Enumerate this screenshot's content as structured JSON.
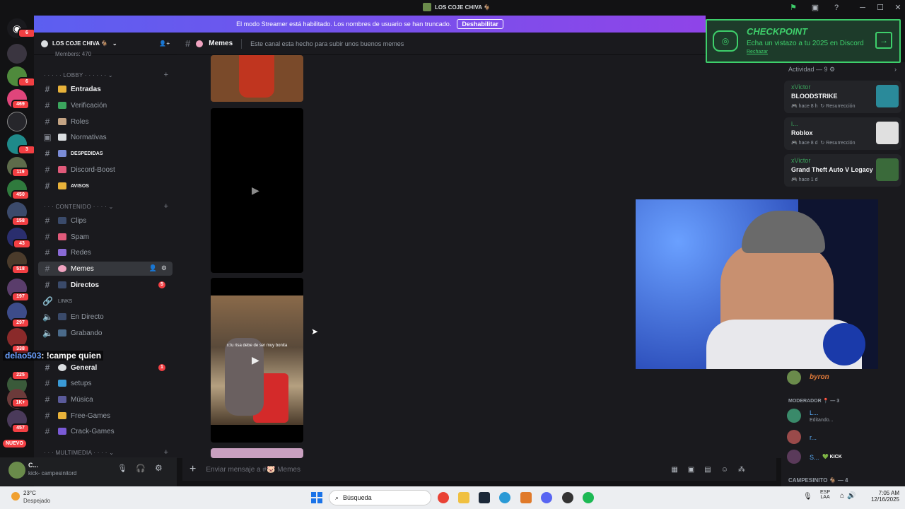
{
  "window": {
    "title": "LOS COJE CHIVA 🐐"
  },
  "banner": {
    "text": "El modo Streamer está habilitado. Los nombres de usuario se han truncado.",
    "button": "Deshabilitar"
  },
  "rail": {
    "badges": [
      "6",
      "6",
      "469",
      "3",
      "119",
      "450",
      "158",
      "43",
      "518",
      "197",
      "297",
      "338",
      "225",
      "1K+",
      "457"
    ],
    "new_label": "NUEVO"
  },
  "guild": {
    "name": "LOS COJE CHIVA 🐐",
    "members_clip": "Members: 470"
  },
  "categories": {
    "lobby": "LOBBY",
    "contenido": "CONTENIDO",
    "multimedia": "MULTIMEDIA"
  },
  "channels": [
    {
      "name": "Entradas",
      "unread": true
    },
    {
      "name": "Verificación"
    },
    {
      "name": "Roles"
    },
    {
      "name": "Normativas"
    },
    {
      "name": "DESPEDIDAS",
      "unread": true
    },
    {
      "name": "Discord-Boost"
    },
    {
      "name": "AVISOS",
      "unread": true
    },
    {
      "name": "Clips"
    },
    {
      "name": "Spam"
    },
    {
      "name": "Redes"
    },
    {
      "name": "Memes",
      "active": true
    },
    {
      "name": "Directos",
      "unread": true,
      "badge": "5"
    },
    {
      "name": "LINKS"
    },
    {
      "name": "En Directo"
    },
    {
      "name": "Grabando"
    },
    {
      "name": "General",
      "unread": true,
      "badge": "1"
    },
    {
      "name": "setups"
    },
    {
      "name": "Música"
    },
    {
      "name": "Free-Games"
    },
    {
      "name": "Crack-Games"
    }
  ],
  "overlay_chat": {
    "user": "delao503",
    "message": ": !campe quien"
  },
  "user_panel": {
    "name": "C...",
    "status": "kick- campesinitord"
  },
  "chat": {
    "channel_name": "Memes",
    "topic": "Este canal esta hecho para subir unos buenos memes",
    "video_caption": "x:tu risa debe de ser muy bonita",
    "composer_placeholder": "Enviar mensaje a #🐷 Memes"
  },
  "checkpoint": {
    "title": "CHECKPOINT",
    "subtitle": "Echa un vistazo a tu 2025 en Discord",
    "dismiss": "Rechazar"
  },
  "members": {
    "activity_header": "Actividad — 9",
    "activities": [
      {
        "user": "xVictor",
        "game": "BLOODSTRIKE",
        "meta": "hace 8 h",
        "meta2": "Resurrección"
      },
      {
        "user": "i...",
        "game": "Roblox",
        "meta": "hace 8 d",
        "meta2": "Resurrección"
      },
      {
        "user": "xVictor",
        "game": "Grand Theft Auto V Legacy",
        "meta": "hace 1 d"
      }
    ],
    "byron": "byron",
    "moderator_header": "MODERADOR 📍 — 3",
    "mods": [
      {
        "name": "L...",
        "status": "Editando..."
      },
      {
        "name": "r..."
      },
      {
        "name": "S...",
        "tag": "KICK"
      }
    ],
    "campesinito_header": "CAMPESINITO 🐐 — 4"
  },
  "taskbar": {
    "weather_temp": "23°C",
    "weather_desc": "Despejado",
    "search": "Búsqueda",
    "lang": "ESP",
    "lang2": "LAA",
    "time": "7:05 AM",
    "date": "12/16/2025"
  },
  "colors": {
    "accent": "#5865f2",
    "banner_end": "#8f44e8",
    "checkpoint_green": "#3ecf6b",
    "badge_red": "#f23f43"
  }
}
